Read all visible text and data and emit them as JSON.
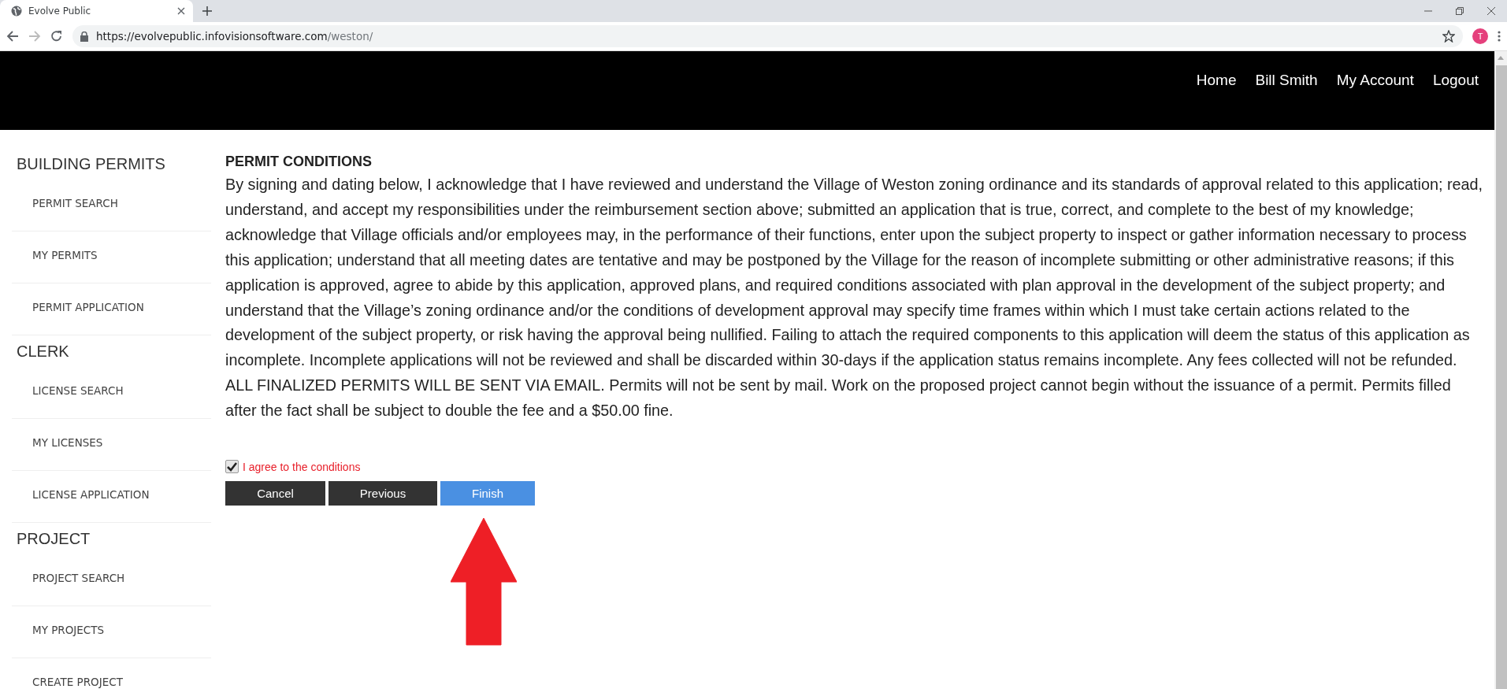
{
  "browser": {
    "tab_title": "Evolve Public",
    "url_host": "https://evolvepublic.infovisionsoftware.com",
    "url_path": "/weston/",
    "back_disabled": false,
    "forward_disabled": true,
    "profile_initial": "T"
  },
  "header": {
    "nav": [
      "Home",
      "Bill Smith",
      "My Account",
      "Logout"
    ]
  },
  "sidebar": {
    "sections": [
      {
        "heading": "BUILDING PERMITS",
        "items": [
          "PERMIT SEARCH",
          "MY PERMITS",
          "PERMIT APPLICATION"
        ]
      },
      {
        "heading": "CLERK",
        "items": [
          "LICENSE SEARCH",
          "MY LICENSES",
          "LICENSE APPLICATION"
        ]
      },
      {
        "heading": "PROJECT",
        "items": [
          "PROJECT SEARCH",
          "MY PROJECTS",
          "CREATE PROJECT"
        ]
      }
    ]
  },
  "conditions": {
    "title": "PERMIT CONDITIONS",
    "text": "By signing and dating below, I acknowledge that I have reviewed and understand the Village of Weston zoning ordinance and its standards of approval related to this application; read, understand, and accept my responsibilities under the reimbursement section above; submitted an application that is true, correct, and complete to the best of my knowledge; acknowledge that Village officials and/or employees may, in the performance of their functions, enter upon the subject property to inspect or gather information necessary to process this application; understand that all meeting dates are tentative and may be postponed by the Village for the reason of incomplete submitting or other administrative reasons; if this application is approved, agree to abide by this application, approved plans, and required conditions associated with plan approval in the development of the subject property; and understand that the Village’s zoning ordinance and/or the conditions of development approval may specify time frames within which I must take certain actions related to the development of the subject property, or risk having the approval being nullified. Failing to attach the required components to this application will deem the status of this application as incomplete. Incomplete applications will not be reviewed and shall be discarded within 30-days if the application status remains incomplete. Any fees collected will not be refunded. ALL FINALIZED PERMITS WILL BE SENT VIA EMAIL. Permits will not be sent by mail. Work on the proposed project cannot begin without the issuance of a permit. Permits filled after the fact shall be subject to double the fee and a $50.00 fine.",
    "agree": {
      "label": "I agree to the conditions",
      "checked": true
    },
    "buttons": [
      {
        "label": "Cancel",
        "kind": "default"
      },
      {
        "label": "Previous",
        "kind": "default"
      },
      {
        "label": "Finish",
        "kind": "primary"
      }
    ]
  }
}
